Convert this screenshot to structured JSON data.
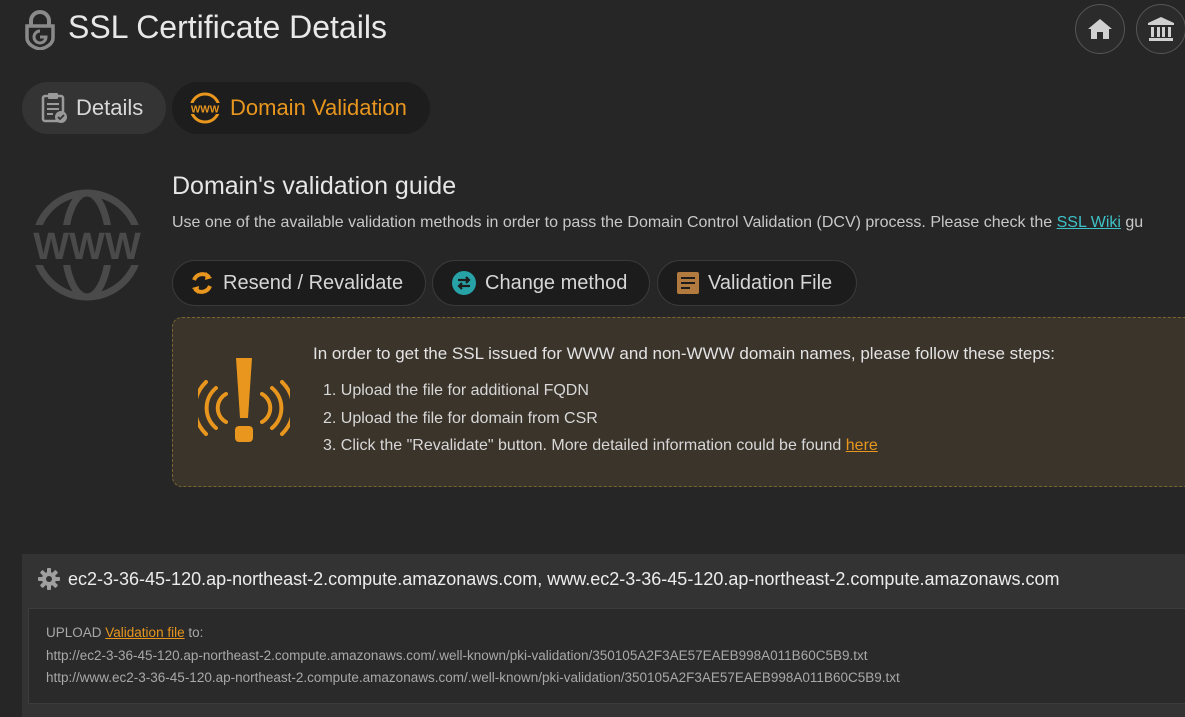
{
  "header": {
    "title": "SSL Certificate Details",
    "home_icon": "home-icon",
    "bank_icon": "institution-icon"
  },
  "tabs": [
    {
      "label": "Details",
      "icon": "clipboard-check-icon",
      "active": false
    },
    {
      "label": "Domain Validation",
      "icon": "www-globe-icon",
      "active": true
    }
  ],
  "guide": {
    "title": "Domain's validation guide",
    "text_before_link": "Use one of the available validation methods in order to pass the Domain Control Validation (DCV) process. Please check the ",
    "link_text": "SSL Wiki",
    "text_after_link": " gu"
  },
  "actions": {
    "resend_label": "Resend / Revalidate",
    "change_label": "Change method",
    "file_label": "Validation File"
  },
  "notice": {
    "intro": "In order to get the SSL issued for WWW and non-WWW domain names, please follow these steps:",
    "step1": "1. Upload the file for additional FQDN",
    "step2": "2. Upload the file for domain from CSR",
    "step3_text": "3. Click the \"Revalidate\" button. More detailed information could be found ",
    "step3_link": "here"
  },
  "domain": {
    "names": "ec2-3-36-45-120.ap-northeast-2.compute.amazonaws.com, www.ec2-3-36-45-120.ap-northeast-2.compute.amazonaws.com",
    "upload_prefix": "UPLOAD ",
    "upload_link": "Validation file",
    "upload_suffix": " to:",
    "url1": "http://ec2-3-36-45-120.ap-northeast-2.compute.amazonaws.com/.well-known/pki-validation/350105A2F3AE57EAEB998A011B60C5B9.txt",
    "url2": "http://www.ec2-3-36-45-120.ap-northeast-2.compute.amazonaws.com/.well-known/pki-validation/350105A2F3AE57EAEB998A011B60C5B9.txt"
  },
  "colors": {
    "accent_orange": "#e8961e",
    "link_teal": "#3ec1c8",
    "background": "#262626"
  }
}
